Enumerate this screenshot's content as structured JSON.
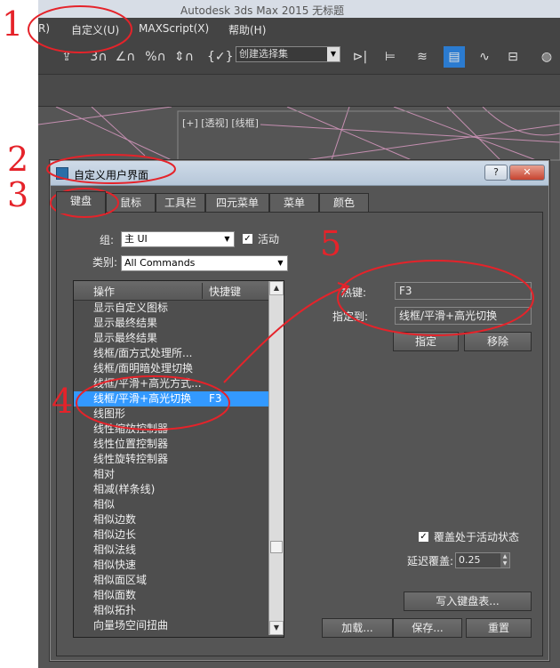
{
  "app": {
    "title": "Autodesk 3ds Max  2015     无标题",
    "menu": [
      "R)",
      "自定义(U)",
      "MAXScript(X)",
      "帮助(H)"
    ],
    "toolbar": {
      "selection_set_placeholder": "创建选择集"
    },
    "viewport_label": "[+] [透视] [线框]"
  },
  "dialog": {
    "title": "自定义用户界面",
    "help_label": "?",
    "close_label": "✕",
    "tabs": [
      {
        "label": "键盘",
        "active": true
      },
      {
        "label": "鼠标",
        "active": false
      },
      {
        "label": "工具栏",
        "active": false
      },
      {
        "label": "四元菜单",
        "active": false
      },
      {
        "label": "菜单",
        "active": false
      },
      {
        "label": "颜色",
        "active": false
      }
    ],
    "group_label": "组:",
    "group_value": "主 UI",
    "active_label": "活动",
    "active_checked": true,
    "category_label": "类别:",
    "category_value": "All Commands",
    "list": {
      "col_action": "操作",
      "col_shortcut": "快捷键",
      "rows": [
        {
          "action": "显示自定义图标",
          "key": ""
        },
        {
          "action": "显示最终结果",
          "key": ""
        },
        {
          "action": "显示最终结果",
          "key": ""
        },
        {
          "action": "线框/面方式处理所...",
          "key": ""
        },
        {
          "action": "线框/面明暗处理切换",
          "key": ""
        },
        {
          "action": "线框/平滑+高光方式...",
          "key": ""
        },
        {
          "action": "线框/平滑+高光切换",
          "key": "F3",
          "selected": true
        },
        {
          "action": "线图形",
          "key": ""
        },
        {
          "action": "线性缩放控制器",
          "key": ""
        },
        {
          "action": "线性位置控制器",
          "key": ""
        },
        {
          "action": "线性旋转控制器",
          "key": ""
        },
        {
          "action": "相对",
          "key": ""
        },
        {
          "action": "相减(样条线)",
          "key": ""
        },
        {
          "action": "相似",
          "key": ""
        },
        {
          "action": "相似边数",
          "key": ""
        },
        {
          "action": "相似边长",
          "key": ""
        },
        {
          "action": "相似法线",
          "key": ""
        },
        {
          "action": "相似快速",
          "key": ""
        },
        {
          "action": "相似面区域",
          "key": ""
        },
        {
          "action": "相似面数",
          "key": ""
        },
        {
          "action": "相似拓扑",
          "key": ""
        },
        {
          "action": "向量场空间扭曲",
          "key": ""
        }
      ]
    },
    "hotkey_label": "热键:",
    "hotkey_value": "F3",
    "assigned_to_label": "指定到:",
    "assigned_to_value": "线框/平滑+高光切换",
    "assign_button": "指定",
    "remove_button": "移除",
    "override_label": "覆盖处于活动状态",
    "override_checked": true,
    "delay_label": "延迟覆盖:",
    "delay_value": "0.25",
    "write_button": "写入键盘表...",
    "load_button": "加载...",
    "save_button": "保存...",
    "reset_button": "重置"
  },
  "annotations": [
    "1",
    "2",
    "3",
    "4",
    "5"
  ]
}
